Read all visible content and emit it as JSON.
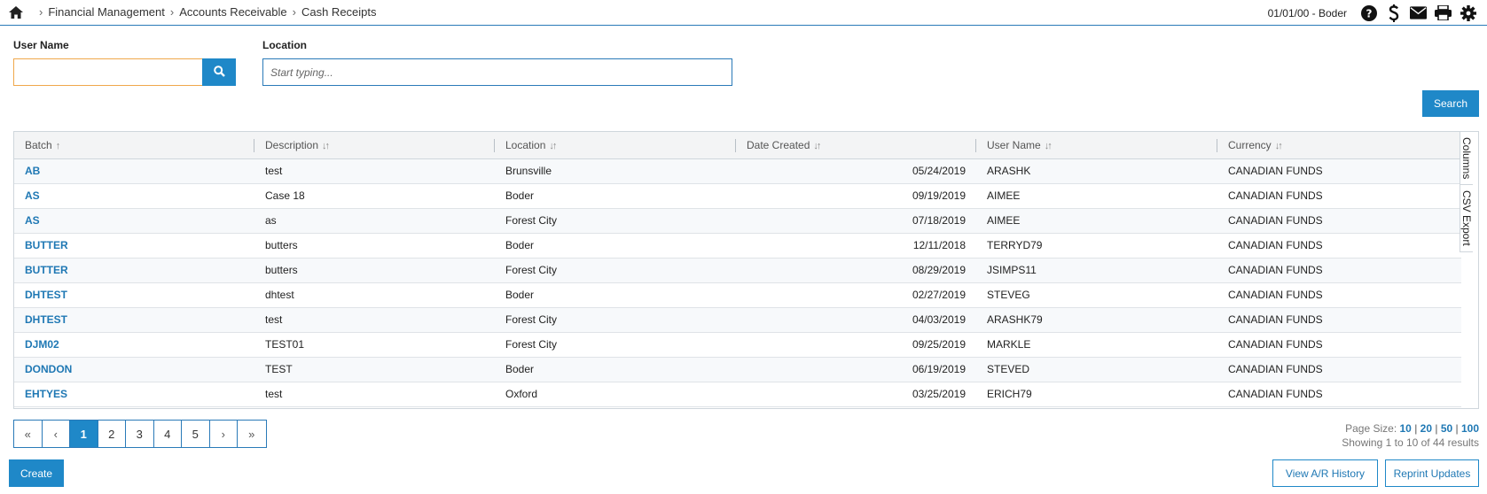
{
  "breadcrumb": {
    "items": [
      "Financial Management",
      "Accounts Receivable",
      "Cash Receipts"
    ],
    "separator": "›"
  },
  "header": {
    "session": "01/01/00 - Boder",
    "icons": [
      "help-icon",
      "dollar-icon",
      "mail-icon",
      "print-icon",
      "gear-icon"
    ]
  },
  "filters": {
    "username_label": "User Name",
    "username_value": "",
    "location_label": "Location",
    "location_placeholder": "Start typing...",
    "search_label": "Search"
  },
  "grid": {
    "columns": [
      {
        "label": "Batch",
        "sort": "↑"
      },
      {
        "label": "Description",
        "sort": "↓↑"
      },
      {
        "label": "Location",
        "sort": "↓↑"
      },
      {
        "label": "Date Created",
        "sort": "↓↑"
      },
      {
        "label": "User Name",
        "sort": "↓↑"
      },
      {
        "label": "Currency",
        "sort": "↓↑"
      }
    ],
    "rows": [
      {
        "batch": "AB",
        "description": "test",
        "location": "Brunsville",
        "date": "05/24/2019",
        "user": "ARASHK",
        "currency": "CANADIAN FUNDS"
      },
      {
        "batch": "AS",
        "description": "Case 18",
        "location": "Boder",
        "date": "09/19/2019",
        "user": "AIMEE",
        "currency": "CANADIAN FUNDS"
      },
      {
        "batch": "AS",
        "description": "as",
        "location": "Forest City",
        "date": "07/18/2019",
        "user": "AIMEE",
        "currency": "CANADIAN FUNDS"
      },
      {
        "batch": "BUTTER",
        "description": "butters",
        "location": "Boder",
        "date": "12/11/2018",
        "user": "TERRYD79",
        "currency": "CANADIAN FUNDS"
      },
      {
        "batch": "BUTTER",
        "description": "butters",
        "location": "Forest City",
        "date": "08/29/2019",
        "user": "JSIMPS11",
        "currency": "CANADIAN FUNDS"
      },
      {
        "batch": "DHTEST",
        "description": "dhtest",
        "location": "Boder",
        "date": "02/27/2019",
        "user": "STEVEG",
        "currency": "CANADIAN FUNDS"
      },
      {
        "batch": "DHTEST",
        "description": "test",
        "location": "Forest City",
        "date": "04/03/2019",
        "user": "ARASHK79",
        "currency": "CANADIAN FUNDS"
      },
      {
        "batch": "DJM02",
        "description": "TEST01",
        "location": "Forest City",
        "date": "09/25/2019",
        "user": "MARKLE",
        "currency": "CANADIAN FUNDS"
      },
      {
        "batch": "DONDON",
        "description": "TEST",
        "location": "Boder",
        "date": "06/19/2019",
        "user": "STEVED",
        "currency": "CANADIAN FUNDS"
      },
      {
        "batch": "EHTYES",
        "description": "test",
        "location": "Oxford",
        "date": "03/25/2019",
        "user": "ERICH79",
        "currency": "CANADIAN FUNDS"
      }
    ],
    "side_tabs": [
      "Columns",
      "CSV Export"
    ]
  },
  "pager": {
    "first": "«",
    "prev": "‹",
    "pages": [
      "1",
      "2",
      "3",
      "4",
      "5"
    ],
    "active_page": "1",
    "next": "›",
    "last": "»"
  },
  "page_size": {
    "label": "Page Size:",
    "options": [
      "10",
      "20",
      "50",
      "100"
    ],
    "selected": "10",
    "summary": "Showing 1 to 10 of 44 results"
  },
  "actions": {
    "create": "Create",
    "view_history": "View A/R History",
    "reprint": "Reprint Updates"
  },
  "colors": {
    "accent": "#1f88c8",
    "link": "#1f78b4",
    "focus_border": "#f0a84b"
  }
}
